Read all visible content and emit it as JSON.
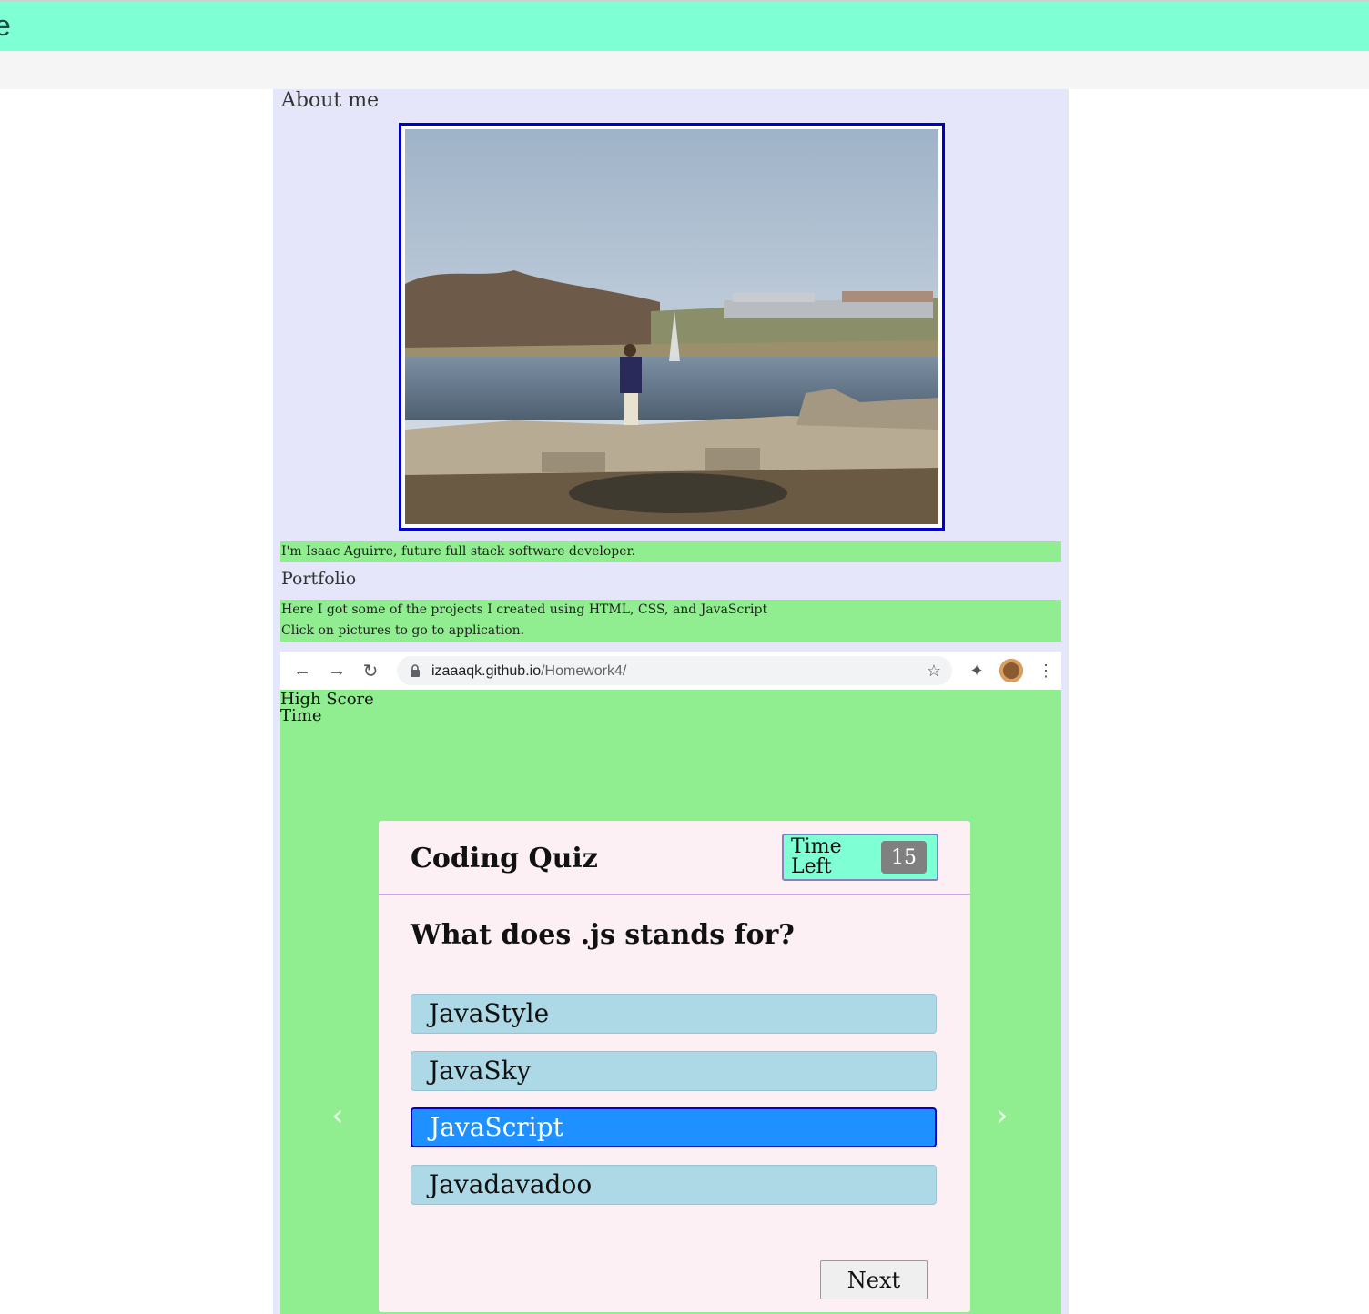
{
  "header": {
    "title_fragment": "e"
  },
  "about": {
    "title": "About me",
    "intro": "I'm Isaac Aguirre, future full stack software developer."
  },
  "portfolio": {
    "title": "Portfolio",
    "line1": "Here I got some of the projects I created using HTML, CSS, and JavaScript",
    "line2": "Click on pictures to go to application."
  },
  "browser": {
    "url_host": "izaaaqk.github.io",
    "url_path": "/Homework4/"
  },
  "quiz": {
    "high_score_label": "High Score",
    "time_label": "Time",
    "title": "Coding Quiz",
    "timer_label": "Time Left",
    "timer_value": "15",
    "question": "What does .js stands for?",
    "answers": [
      "JavaStyle",
      "JavaSky",
      "JavaScript",
      "Javadavadoo"
    ],
    "selected_answer": "JavaScript",
    "next_label": "Next"
  },
  "carousel": {
    "prev_glyph": "‹",
    "next_glyph": "›"
  },
  "colors": {
    "banner": "#7fffd4",
    "panel": "#e6e6fa",
    "green": "#90ee90",
    "selected": "#1e90ff",
    "answer": "#add8e6"
  },
  "icons": [
    "back-arrow-icon",
    "forward-arrow-icon",
    "reload-icon",
    "lock-icon",
    "star-icon",
    "extensions-icon",
    "avatar",
    "menu-dots-icon"
  ]
}
